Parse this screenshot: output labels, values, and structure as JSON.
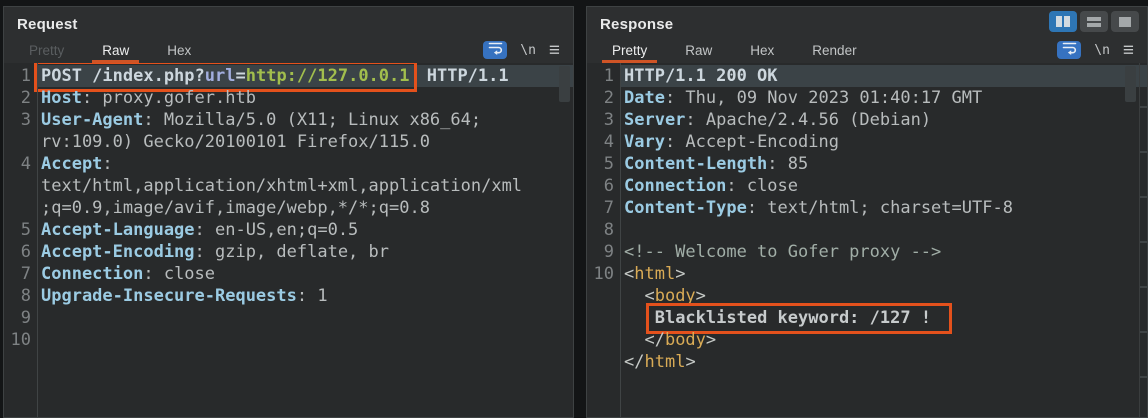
{
  "window": {
    "layout_buttons": [
      {
        "name": "columns-view",
        "active": true
      },
      {
        "name": "rows-view",
        "active": false
      },
      {
        "name": "single-view",
        "active": false
      }
    ]
  },
  "colors": {
    "accent_orange": "#e4511c",
    "tab_underline_orange": "#cf5426",
    "active_layout_blue": "#2e76b5",
    "wrap_button_blue": "#3672c0",
    "selected_line_bg": "#3b4347"
  },
  "request_panel": {
    "title": "Request",
    "tabs": [
      {
        "label": "Pretty",
        "state": "disabled"
      },
      {
        "label": "Raw",
        "state": "active"
      },
      {
        "label": "Hex",
        "state": "normal"
      }
    ],
    "wrap_label": "\\n",
    "menu_glyph": "≡",
    "lines": [
      {
        "num": "1",
        "sel": true,
        "bold": true,
        "seg": [
          {
            "t": "POST /index.php?",
            "c": "plain",
            "b": true
          },
          {
            "t": "url",
            "c": "param",
            "b": true
          },
          {
            "t": "=",
            "c": "plain",
            "b": true
          },
          {
            "t": "http://127.0.0.1",
            "c": "url",
            "b": true
          },
          {
            "t": " HTTP/1.1",
            "c": "plain"
          }
        ]
      },
      {
        "num": "2",
        "seg": [
          {
            "t": "Host",
            "c": "hname"
          },
          {
            "t": ": proxy.gofer.htb",
            "c": "hval"
          }
        ]
      },
      {
        "num": "3",
        "seg": [
          {
            "t": "User-Agent",
            "c": "hname"
          },
          {
            "t": ": Mozilla/5.0 (X11; Linux x86_64;",
            "c": "hval"
          }
        ]
      },
      {
        "num": "",
        "seg": [
          {
            "t": "rv:109.0) Gecko/20100101 Firefox/115.0",
            "c": "hval"
          }
        ]
      },
      {
        "num": "4",
        "seg": [
          {
            "t": "Accept",
            "c": "hname"
          },
          {
            "t": ":",
            "c": "hval"
          }
        ]
      },
      {
        "num": "",
        "seg": [
          {
            "t": "text/html,application/xhtml+xml,application/xml",
            "c": "hval"
          }
        ]
      },
      {
        "num": "",
        "seg": [
          {
            "t": ";q=0.9,image/avif,image/webp,*/*;q=0.8",
            "c": "hval"
          }
        ]
      },
      {
        "num": "5",
        "seg": [
          {
            "t": "Accept-Language",
            "c": "hname"
          },
          {
            "t": ": en-US,en;q=0.5",
            "c": "hval"
          }
        ]
      },
      {
        "num": "6",
        "seg": [
          {
            "t": "Accept-Encoding",
            "c": "hname"
          },
          {
            "t": ": gzip, deflate, br",
            "c": "hval"
          }
        ]
      },
      {
        "num": "7",
        "seg": [
          {
            "t": "Connection",
            "c": "hname"
          },
          {
            "t": ": close",
            "c": "hval"
          }
        ]
      },
      {
        "num": "8",
        "seg": [
          {
            "t": "Upgrade-Insecure-Requests",
            "c": "hname"
          },
          {
            "t": ": 1",
            "c": "hval"
          }
        ]
      },
      {
        "num": "9",
        "seg": []
      },
      {
        "num": "10",
        "seg": []
      }
    ]
  },
  "response_panel": {
    "title": "Response",
    "tabs": [
      {
        "label": "Pretty",
        "state": "active"
      },
      {
        "label": "Raw",
        "state": "normal"
      },
      {
        "label": "Hex",
        "state": "normal"
      },
      {
        "label": "Render",
        "state": "normal"
      }
    ],
    "wrap_label": "\\n",
    "menu_glyph": "≡",
    "lines": [
      {
        "num": "1",
        "sel": true,
        "bold": true,
        "seg": [
          {
            "t": "HTTP/1.1 200 OK",
            "c": "plain"
          }
        ]
      },
      {
        "num": "2",
        "seg": [
          {
            "t": "Date",
            "c": "hname"
          },
          {
            "t": ": Thu, 09 Nov 2023 01:40:17 GMT",
            "c": "hval"
          }
        ]
      },
      {
        "num": "3",
        "seg": [
          {
            "t": "Server",
            "c": "hname"
          },
          {
            "t": ": Apache/2.4.56 (Debian)",
            "c": "hval"
          }
        ]
      },
      {
        "num": "4",
        "seg": [
          {
            "t": "Vary",
            "c": "hname"
          },
          {
            "t": ": Accept-Encoding",
            "c": "hval"
          }
        ]
      },
      {
        "num": "5",
        "seg": [
          {
            "t": "Content-Length",
            "c": "hname"
          },
          {
            "t": ": 85",
            "c": "hval"
          }
        ]
      },
      {
        "num": "6",
        "seg": [
          {
            "t": "Connection",
            "c": "hname"
          },
          {
            "t": ": close",
            "c": "hval"
          }
        ]
      },
      {
        "num": "7",
        "seg": [
          {
            "t": "Content-Type",
            "c": "hname"
          },
          {
            "t": ": text/html; charset=UTF-8",
            "c": "hval"
          }
        ]
      },
      {
        "num": "8",
        "seg": []
      },
      {
        "num": "9",
        "seg": [
          {
            "t": "<!-- Welcome to Gofer proxy -->",
            "c": "comment"
          }
        ]
      },
      {
        "num": "10",
        "seg": [
          {
            "t": "<",
            "c": "bracket"
          },
          {
            "t": "html",
            "c": "tag"
          },
          {
            "t": ">",
            "c": "bracket"
          }
        ]
      },
      {
        "num": "",
        "seg": [
          {
            "t": "  <",
            "c": "bracket"
          },
          {
            "t": "body",
            "c": "tag"
          },
          {
            "t": ">",
            "c": "bracket"
          }
        ]
      },
      {
        "num": "",
        "seg": [
          {
            "t": "   ",
            "c": "btext"
          },
          {
            "t": "Blacklisted keyword: /127 !",
            "c": "btext",
            "b": true
          }
        ]
      },
      {
        "num": "",
        "seg": [
          {
            "t": "  </",
            "c": "bracket"
          },
          {
            "t": "body",
            "c": "tag"
          },
          {
            "t": ">",
            "c": "bracket"
          }
        ]
      },
      {
        "num": "",
        "seg": [
          {
            "t": "</",
            "c": "bracket"
          },
          {
            "t": "html",
            "c": "tag"
          },
          {
            "t": ">",
            "c": "bracket"
          }
        ]
      }
    ]
  }
}
